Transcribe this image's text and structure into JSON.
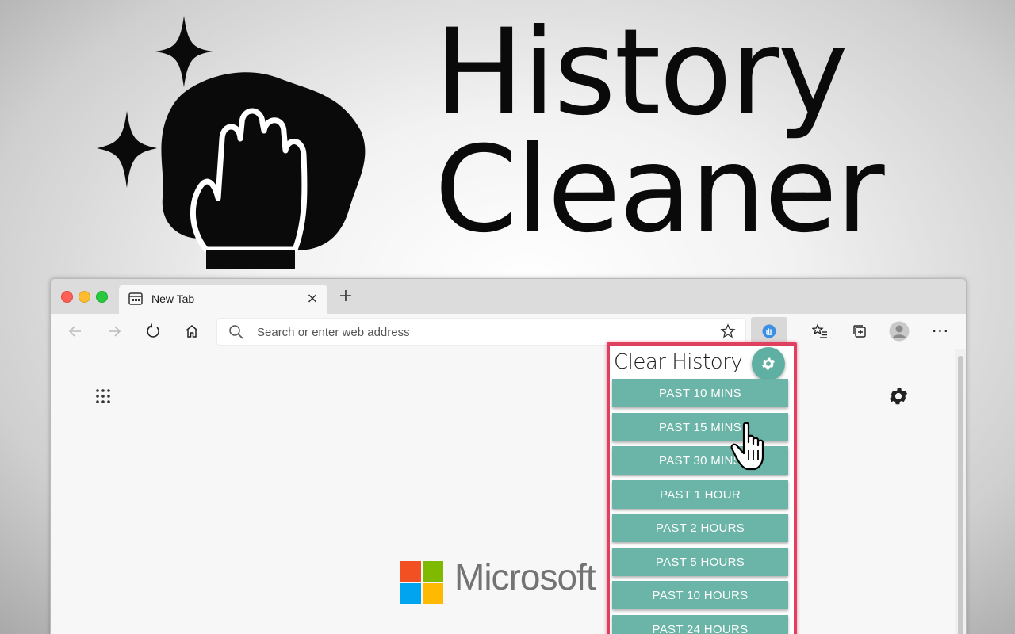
{
  "hero": {
    "title_line1": "History",
    "title_line2": "Cleaner"
  },
  "browser": {
    "tab": {
      "title": "New Tab",
      "close_label": "×"
    },
    "new_tab_label": "+",
    "address": {
      "placeholder": "Search or enter web address"
    },
    "brand": {
      "name": "Microsoft"
    },
    "more_label": "···"
  },
  "popup": {
    "title": "Clear History",
    "options": [
      "PAST 10 MINS",
      "PAST 15 MINS",
      "PAST 30 MINS",
      "PAST 1 HOUR",
      "PAST 2 HOURS",
      "PAST 5 HOURS",
      "PAST 10 HOURS",
      "PAST 24 HOURS"
    ]
  },
  "colors": {
    "accent": "#6bb5a8",
    "highlight": "#e0405f",
    "ms_red": "#f25022",
    "ms_green": "#7fba00",
    "ms_blue": "#00a4ef",
    "ms_yellow": "#ffb900"
  }
}
